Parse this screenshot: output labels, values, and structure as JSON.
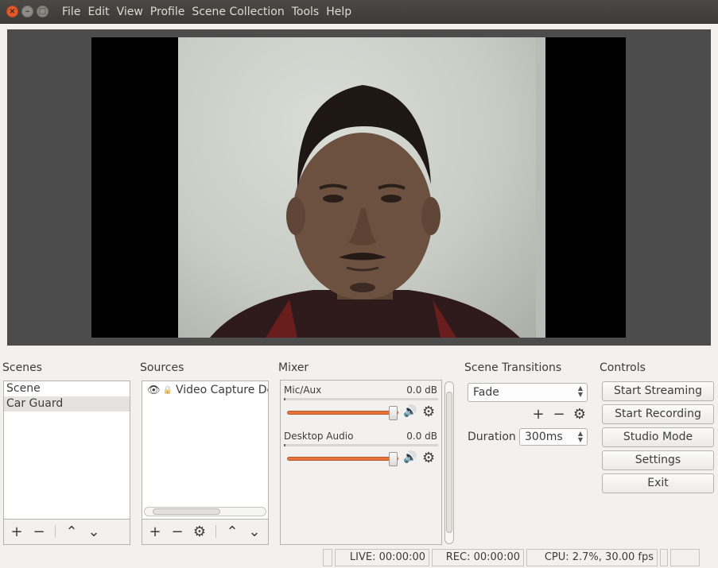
{
  "window": {
    "close_glyph": "×",
    "min_glyph": "–",
    "max_glyph": "□"
  },
  "menu": [
    "File",
    "Edit",
    "View",
    "Profile",
    "Scene Collection",
    "Tools",
    "Help"
  ],
  "panels": {
    "scenes_label": "Scenes",
    "sources_label": "Sources",
    "mixer_label": "Mixer",
    "transitions_label": "Scene Transitions",
    "controls_label": "Controls"
  },
  "scenes": [
    "Scene",
    "Car Guard"
  ],
  "selected_scene": "Car Guard",
  "sources": [
    {
      "name": "Video Capture De",
      "visible": true,
      "locked": false
    }
  ],
  "mixer": [
    {
      "name": "Mic/Aux",
      "db": "0.0 dB",
      "volume": 0.93
    },
    {
      "name": "Desktop Audio",
      "db": "0.0 dB",
      "volume": 0.93
    }
  ],
  "transitions": {
    "current": "Fade",
    "duration_label": "Duration",
    "duration_value": "300ms"
  },
  "controls": {
    "start_streaming": "Start Streaming",
    "start_recording": "Start Recording",
    "studio_mode": "Studio Mode",
    "settings": "Settings",
    "exit": "Exit"
  },
  "status": {
    "live": "LIVE: 00:00:00",
    "rec": "REC: 00:00:00",
    "cpu": "CPU: 2.7%, 30.00 fps"
  },
  "icons": {
    "add": "+",
    "remove": "−",
    "up": "⌃",
    "down": "⌄",
    "gear": "⚙",
    "speaker": "🔊",
    "eye": "👁",
    "lock": "🔒"
  },
  "colors": {
    "slider": "#e8743b",
    "titlebar": "#3b3a36",
    "preview_bg": "#4c4c4c"
  }
}
